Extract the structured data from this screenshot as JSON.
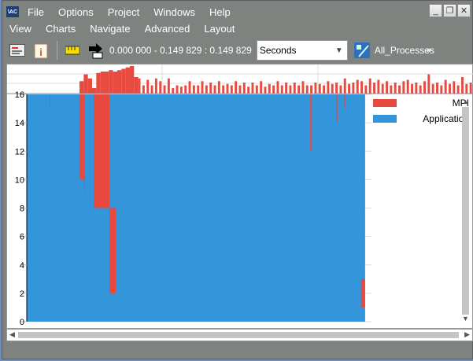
{
  "window": {
    "logo": "ITAC",
    "menu": [
      "File",
      "Options",
      "Project",
      "Windows",
      "Help"
    ],
    "controls": [
      "minimize",
      "restore",
      "close"
    ]
  },
  "menu2": [
    "View",
    "Charts",
    "Navigate",
    "Advanced",
    "Layout"
  ],
  "toolbar": {
    "time_range": "0.000 000 - 0.149 829 : 0.149 829",
    "unit_select": "Seconds",
    "process_group": "All_Processes",
    "overflow": "»"
  },
  "colors": {
    "mpi": "#e84a3f",
    "application": "#3396da"
  },
  "chart_data": {
    "type": "area",
    "title": "Event Timeline",
    "xlim": [
      0,
      0.149829
    ],
    "ylim": [
      0,
      16
    ],
    "yticks": [
      "0",
      "2",
      "4",
      "6",
      "8",
      "10",
      "12",
      "14",
      "16"
    ],
    "legend": [
      {
        "name": "MPI",
        "color": "#e84a3f"
      },
      {
        "name": "Application",
        "color": "#3396da"
      }
    ],
    "legend_position": "right",
    "mpi_regions": [
      {
        "t0": 0.0233,
        "t1": 0.0258,
        "p0": 10,
        "p1": 16
      },
      {
        "t0": 0.0254,
        "t1": 0.0256,
        "p0": 9,
        "p1": 10
      },
      {
        "t0": 0.0296,
        "t1": 0.0366,
        "p0": 8,
        "p1": 16
      },
      {
        "t0": 0.0366,
        "t1": 0.0394,
        "p0": 2,
        "p1": 8
      },
      {
        "t0": 0.1255,
        "t1": 0.1262,
        "p0": 12,
        "p1": 16
      },
      {
        "t0": 0.137,
        "t1": 0.1375,
        "p0": 14,
        "p1": 16
      },
      {
        "t0": 0.1405,
        "t1": 0.141,
        "p0": 15,
        "p1": 16
      },
      {
        "t0": 0.148,
        "t1": 0.1498,
        "p0": 1,
        "p1": 3
      },
      {
        "t0": 0.0101,
        "t1": 0.0104,
        "p0": 15,
        "p1": 16
      }
    ],
    "app_end": 0.1498,
    "histogram": [
      0.45,
      0.7,
      0.55,
      0.2,
      0.75,
      0.8,
      0.8,
      0.85,
      0.8,
      0.85,
      0.9,
      0.95,
      1.0,
      0.6,
      0.55,
      0.3,
      0.5,
      0.3,
      0.55,
      0.45,
      0.3,
      0.55,
      0.2,
      0.3,
      0.25,
      0.3,
      0.45,
      0.3,
      0.3,
      0.45,
      0.3,
      0.4,
      0.3,
      0.45,
      0.3,
      0.35,
      0.3,
      0.45,
      0.3,
      0.4,
      0.25,
      0.4,
      0.3,
      0.45,
      0.25,
      0.35,
      0.3,
      0.45,
      0.3,
      0.4,
      0.3,
      0.4,
      0.3,
      0.45,
      0.3,
      0.3,
      0.4,
      0.35,
      0.3,
      0.45,
      0.35,
      0.4,
      0.3,
      0.55,
      0.35,
      0.4,
      0.5,
      0.45,
      0.3,
      0.55,
      0.4,
      0.5,
      0.35,
      0.45,
      0.3,
      0.4,
      0.3,
      0.45,
      0.5,
      0.35,
      0.4,
      0.3,
      0.45,
      0.7,
      0.35,
      0.4,
      0.3,
      0.5,
      0.35,
      0.45,
      0.3,
      0.6,
      0.35,
      0.4
    ]
  }
}
